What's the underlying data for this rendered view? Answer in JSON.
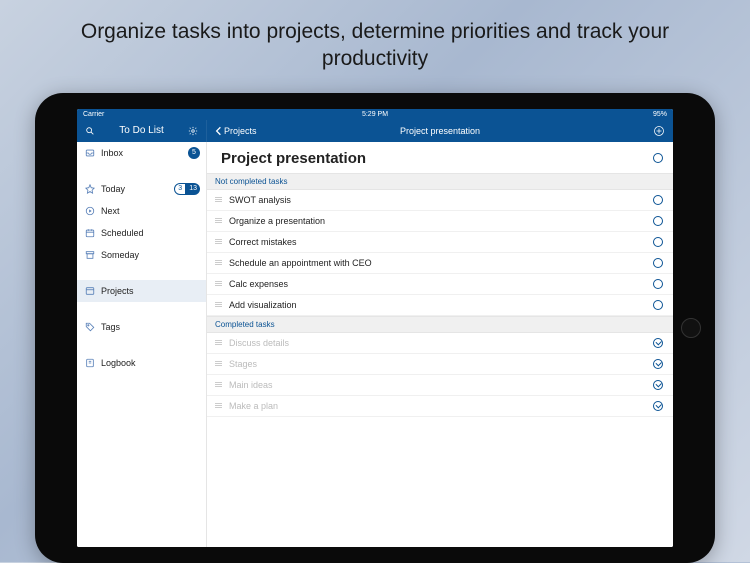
{
  "caption": "Organize tasks into projects, determine priorities and track your productivity",
  "status_bar": {
    "carrier": "Carrier",
    "time": "5:29 PM",
    "battery": "95%"
  },
  "top_nav": {
    "left_title": "To Do List",
    "back_label": "Projects",
    "right_title": "Project presentation"
  },
  "sidebar": {
    "items": [
      {
        "label": "Inbox",
        "badge": "5"
      },
      {
        "label": "Today",
        "badge_pair": [
          "3",
          "13"
        ]
      },
      {
        "label": "Next"
      },
      {
        "label": "Scheduled"
      },
      {
        "label": "Someday"
      },
      {
        "label": "Projects",
        "selected": true
      },
      {
        "label": "Tags"
      },
      {
        "label": "Logbook"
      }
    ]
  },
  "main": {
    "project_title": "Project presentation",
    "sections": {
      "not_completed": {
        "header": "Not completed tasks",
        "tasks": [
          "SWOT analysis",
          "Organize a presentation",
          "Correct mistakes",
          "Schedule an appointment with CEO",
          "Calc expenses",
          "Add visualization"
        ]
      },
      "completed": {
        "header": "Completed tasks",
        "tasks": [
          "Discuss details",
          "Stages",
          "Main ideas",
          "Make a plan"
        ]
      }
    }
  }
}
